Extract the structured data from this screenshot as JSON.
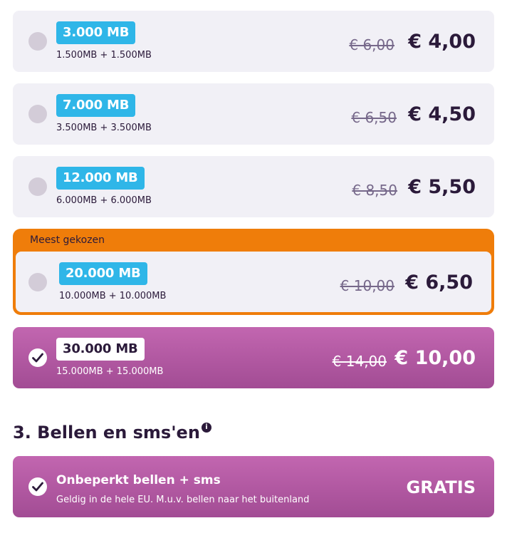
{
  "plans": [
    {
      "mb": "3.000 MB",
      "split": "1.500MB + 1.500MB",
      "old_price": "€ 6,00",
      "price": "€ 4,00"
    },
    {
      "mb": "7.000 MB",
      "split": "3.500MB + 3.500MB",
      "old_price": "€ 6,50",
      "price": "€ 4,50"
    },
    {
      "mb": "12.000 MB",
      "split": "6.000MB + 6.000MB",
      "old_price": "€ 8,50",
      "price": "€ 5,50"
    },
    {
      "mb": "20.000 MB",
      "split": "10.000MB + 10.000MB",
      "old_price": "€ 10,00",
      "price": "€ 6,50",
      "tag": "Meest gekozen"
    },
    {
      "mb": "30.000 MB",
      "split": "15.000MB + 15.000MB",
      "old_price": "€ 14,00",
      "price": "€ 10,00",
      "selected": true
    }
  ],
  "calling": {
    "section_title": "3. Bellen en sms'en",
    "info_icon": "i",
    "option_title": "Onbeperkt bellen + sms",
    "option_desc": "Geldig in de hele EU. M.u.v. bellen naar het buitenland",
    "option_price": "GRATIS",
    "selected": true
  },
  "colors": {
    "badge_blue": "#2fb6e8",
    "popular_orange": "#ef7d0a",
    "selected_purple": "#b25aa3",
    "text_dark": "#2b1a3a"
  }
}
